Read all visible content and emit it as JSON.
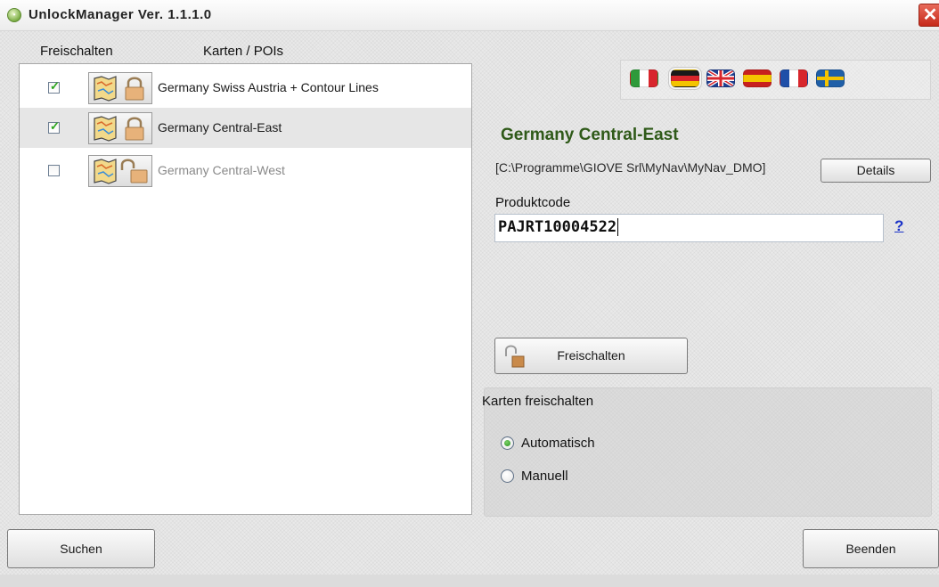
{
  "window": {
    "title": "UnlockManager Ver. 1.1.1.0",
    "close_symbol": "✕"
  },
  "list": {
    "headers": [
      "Freischalten",
      "Karten / POIs"
    ],
    "items": [
      {
        "label": "Germany Swiss Austria + Contour Lines",
        "checked": true,
        "locked": true,
        "enabled": true
      },
      {
        "label": "Germany Central-East",
        "checked": true,
        "locked": true,
        "enabled": true,
        "selected": true
      },
      {
        "label": "Germany Central-West",
        "checked": false,
        "locked": false,
        "enabled": false
      }
    ]
  },
  "languages": [
    {
      "code": "it",
      "icon": "italy-flag-icon",
      "colors": [
        "#2f9a3a",
        "#ffffff",
        "#d8262c"
      ]
    },
    {
      "code": "de",
      "icon": "germany-flag-icon",
      "colors": [
        "#1a1a1a",
        "#d8262c",
        "#f4c400"
      ],
      "selected": true
    },
    {
      "code": "en",
      "icon": "uk-flag-icon",
      "colors": [
        "#1f3f8f",
        "#ffffff",
        "#d8262c"
      ]
    },
    {
      "code": "es",
      "icon": "spain-flag-icon",
      "colors": [
        "#c8201e",
        "#f4c400",
        "#c8201e"
      ]
    },
    {
      "code": "fr",
      "icon": "france-flag-icon",
      "colors": [
        "#1f4fa8",
        "#ffffff",
        "#d8262c"
      ]
    },
    {
      "code": "sv",
      "icon": "sweden-flag-icon",
      "colors": [
        "#1f5fa8",
        "#f4c400"
      ]
    }
  ],
  "details": {
    "title": "Germany Central-East",
    "path": "[C:\\Programme\\GIOVE Srl\\MyNav\\MyNav_DMO]",
    "details_button": "Details",
    "code_label": "Produktcode",
    "code_value": "PAJRT10004522",
    "help_link": "?",
    "unlock_button": "Freischalten"
  },
  "unlock_group": {
    "title": "Karten freischalten",
    "options": [
      {
        "label": "Automatisch",
        "selected": true
      },
      {
        "label": "Manuell",
        "selected": false
      }
    ]
  },
  "footer": {
    "search_button": "Suchen",
    "exit_button": "Beenden"
  },
  "colors": {
    "accent_green": "#2f5a19",
    "link_blue": "#1a32c8",
    "check_green": "#2aa51b"
  }
}
